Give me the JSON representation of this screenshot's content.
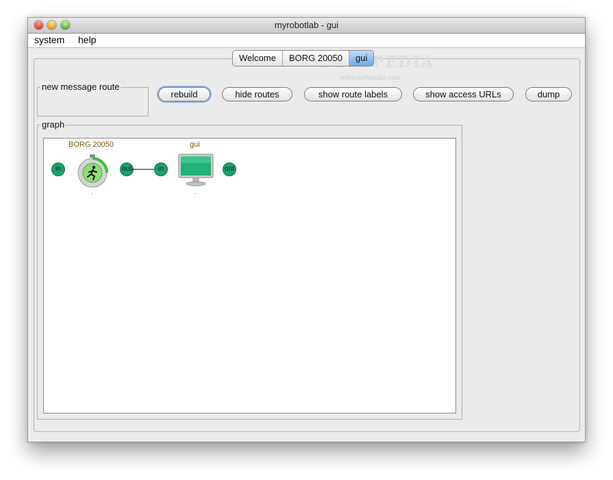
{
  "window": {
    "title": "myrobotlab - gui"
  },
  "menubar": {
    "items": [
      "system",
      "help"
    ]
  },
  "tabs": [
    {
      "label": "Welcome",
      "active": false
    },
    {
      "label": "BORG 20050",
      "active": false
    },
    {
      "label": "gui",
      "active": true
    }
  ],
  "route_panel": {
    "group_label": "new message route",
    "buttons": [
      "rebuild",
      "hide routes",
      "show route labels",
      "show access URLs",
      "dump"
    ]
  },
  "graph": {
    "group_label": "graph",
    "nodes": [
      {
        "name": "BORG 20050",
        "in_label": "in",
        "out_label": "out",
        "caption": ".",
        "icon": "stopwatch-runner-icon"
      },
      {
        "name": "gui",
        "in_label": "in",
        "out_label": "out",
        "caption": ".",
        "icon": "monitor-icon"
      }
    ],
    "edge": "BORG 20050 out -> gui in"
  },
  "watermark": {
    "text": "SOFTPEDIA",
    "sub": "www.softpedia.com"
  },
  "colors": {
    "port_green": "#1aa36b",
    "node_label": "#7a5a00",
    "tab_active": "#6ea9e8"
  }
}
